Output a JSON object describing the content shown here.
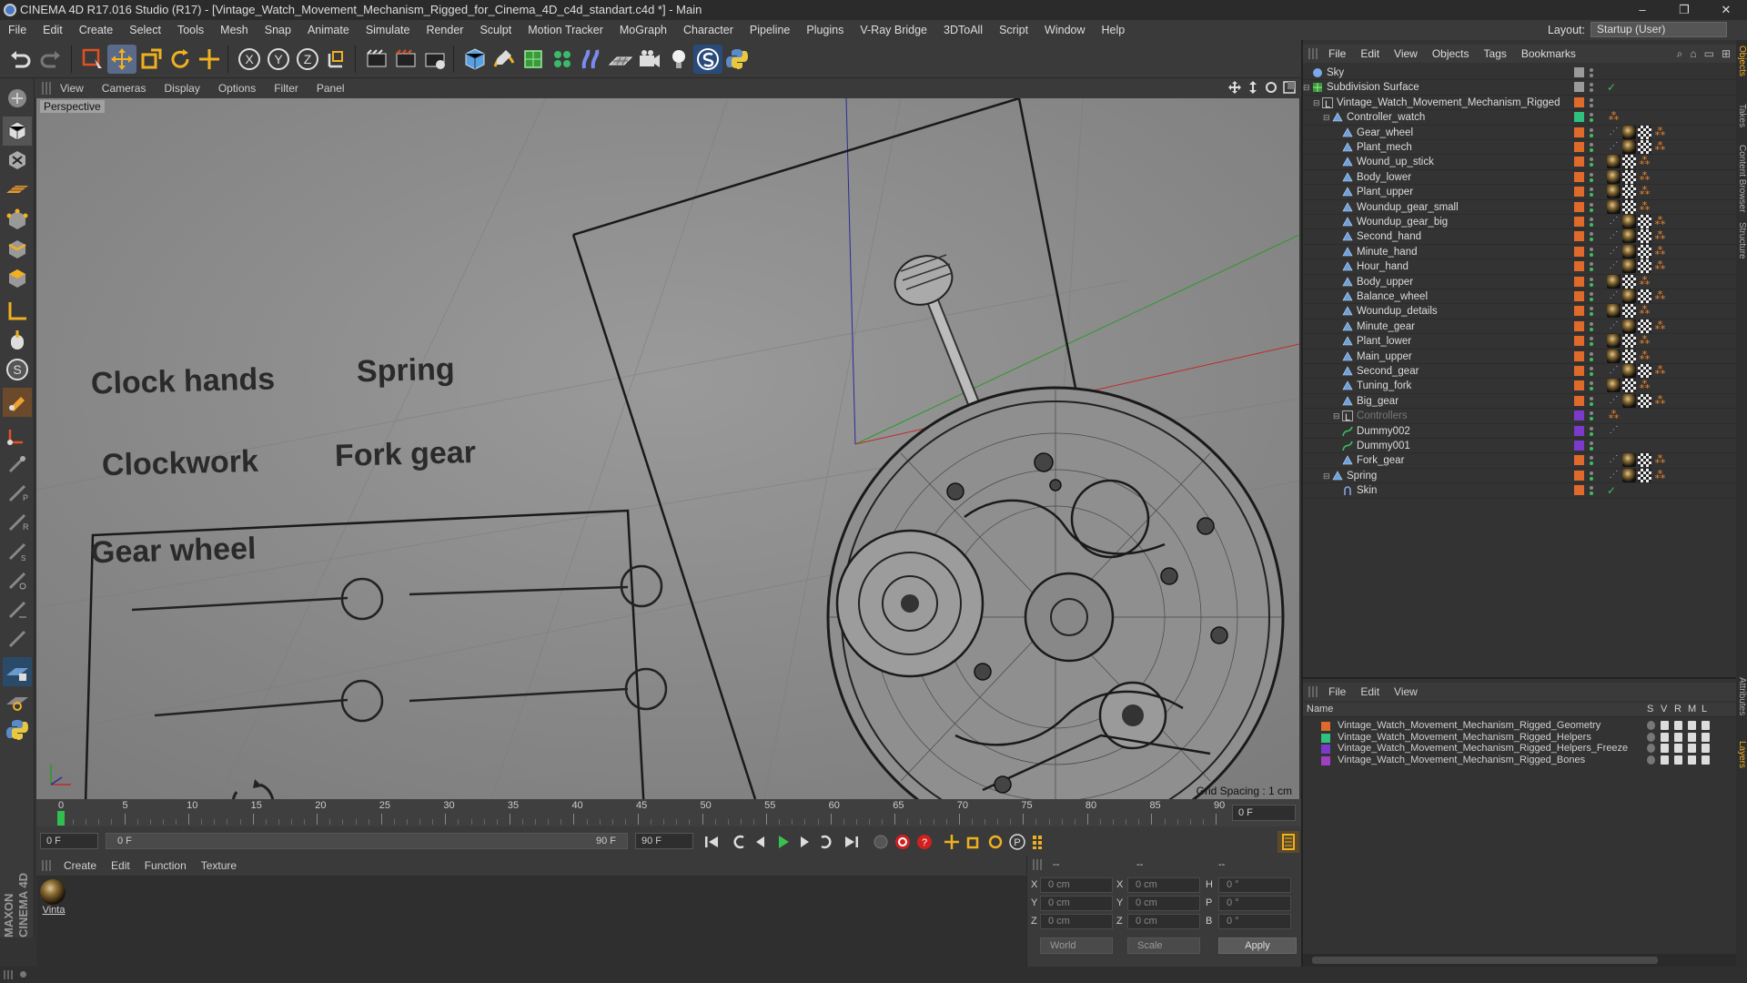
{
  "window": {
    "title": "CINEMA 4D R17.016 Studio (R17) - [Vintage_Watch_Movement_Mechanism_Rigged_for_Cinema_4D_c4d_standart.c4d *] - Main",
    "controls": [
      "–",
      "❐",
      "✕"
    ]
  },
  "menubar": {
    "items": [
      "File",
      "Edit",
      "Create",
      "Select",
      "Tools",
      "Mesh",
      "Snap",
      "Animate",
      "Simulate",
      "Render",
      "Sculpt",
      "Motion Tracker",
      "MoGraph",
      "Character",
      "Pipeline",
      "Plugins",
      "V-Ray Bridge",
      "3DToAll",
      "Script",
      "Window",
      "Help"
    ],
    "layout_label": "Layout:",
    "layout_value": "Startup (User)"
  },
  "viewport": {
    "menu": [
      "View",
      "Cameras",
      "Display",
      "Options",
      "Filter",
      "Panel"
    ],
    "camera_label": "Perspective",
    "grid_spacing": "Grid Spacing : 1 cm",
    "controller_labels": [
      "Clock hands",
      "Spring",
      "Clockwork",
      "Fork gear",
      "Gear wheel"
    ]
  },
  "timeline": {
    "ticks": [
      "0",
      "5",
      "10",
      "15",
      "20",
      "25",
      "30",
      "35",
      "40",
      "45",
      "50",
      "55",
      "60",
      "65",
      "70",
      "75",
      "80",
      "85",
      "90"
    ],
    "current_frame": "0 F"
  },
  "transport": {
    "start_field": "0 F",
    "range_start": "0 F",
    "range_end": "90 F",
    "end_field": "90 F"
  },
  "material_manager": {
    "menu": [
      "Create",
      "Edit",
      "Function",
      "Texture"
    ],
    "materials": [
      {
        "name": "Vinta"
      }
    ]
  },
  "coordinates": {
    "header": [
      "--",
      "--",
      "--"
    ],
    "rows": [
      {
        "a": "X",
        "av": "0 cm",
        "b": "X",
        "bv": "0 cm",
        "c": "H",
        "cv": "0 °"
      },
      {
        "a": "Y",
        "av": "0 cm",
        "b": "Y",
        "bv": "0 cm",
        "c": "P",
        "cv": "0 °"
      },
      {
        "a": "Z",
        "av": "0 cm",
        "b": "Z",
        "bv": "0 cm",
        "c": "B",
        "cv": "0 °"
      }
    ],
    "space": "World",
    "mode": "Scale",
    "apply": "Apply"
  },
  "object_manager": {
    "menu": [
      "File",
      "Edit",
      "View",
      "Objects",
      "Tags",
      "Bookmarks"
    ],
    "objects": [
      {
        "name": "Sky",
        "depth": 0,
        "layer": "#9a9a9a",
        "icon": "sky-icon",
        "tags": [],
        "dim": false
      },
      {
        "name": "Subdivision Surface",
        "depth": 0,
        "layer": "#9a9a9a",
        "icon": "subdivision-icon",
        "tags": [
          "check"
        ],
        "dim": false
      },
      {
        "name": "Vintage_Watch_Movement_Mechanism_Rigged",
        "depth": 1,
        "layer": "#e06a2a",
        "icon": "null-icon",
        "tags": [],
        "dim": false
      },
      {
        "name": "Controller_watch",
        "depth": 2,
        "layer": "#30c080",
        "icon": "polygon-icon",
        "tags": [
          "ik"
        ],
        "dim": false
      },
      {
        "name": "Gear_wheel",
        "depth": 3,
        "layer": "#e06a2a",
        "icon": "polygon-icon",
        "tags": [
          "pin",
          "ball",
          "chk",
          "ik"
        ],
        "dim": false
      },
      {
        "name": "Plant_mech",
        "depth": 3,
        "layer": "#e06a2a",
        "icon": "polygon-icon",
        "tags": [
          "pin",
          "ball",
          "chk",
          "ik"
        ],
        "dim": false
      },
      {
        "name": "Wound_up_stick",
        "depth": 3,
        "layer": "#e06a2a",
        "icon": "polygon-icon",
        "tags": [
          "ball",
          "chk",
          "ik"
        ],
        "dim": false
      },
      {
        "name": "Body_lower",
        "depth": 3,
        "layer": "#e06a2a",
        "icon": "polygon-icon",
        "tags": [
          "ball",
          "chk",
          "ik"
        ],
        "dim": false
      },
      {
        "name": "Plant_upper",
        "depth": 3,
        "layer": "#e06a2a",
        "icon": "polygon-icon",
        "tags": [
          "ball",
          "chk",
          "ik"
        ],
        "dim": false
      },
      {
        "name": "Woundup_gear_small",
        "depth": 3,
        "layer": "#e06a2a",
        "icon": "polygon-icon",
        "tags": [
          "ball",
          "chk",
          "ik"
        ],
        "dim": false
      },
      {
        "name": "Woundup_gear_big",
        "depth": 3,
        "layer": "#e06a2a",
        "icon": "polygon-icon",
        "tags": [
          "pin",
          "ball",
          "chk",
          "ik"
        ],
        "dim": false
      },
      {
        "name": "Second_hand",
        "depth": 3,
        "layer": "#e06a2a",
        "icon": "polygon-icon",
        "tags": [
          "pin",
          "ball",
          "chk",
          "ik"
        ],
        "dim": false
      },
      {
        "name": "Minute_hand",
        "depth": 3,
        "layer": "#e06a2a",
        "icon": "polygon-icon",
        "tags": [
          "pin",
          "ball",
          "chk",
          "ik"
        ],
        "dim": false
      },
      {
        "name": "Hour_hand",
        "depth": 3,
        "layer": "#e06a2a",
        "icon": "polygon-icon",
        "tags": [
          "pin",
          "ball",
          "chk",
          "ik"
        ],
        "dim": false
      },
      {
        "name": "Body_upper",
        "depth": 3,
        "layer": "#e06a2a",
        "icon": "polygon-icon",
        "tags": [
          "ball",
          "chk",
          "ik"
        ],
        "dim": false
      },
      {
        "name": "Balance_wheel",
        "depth": 3,
        "layer": "#e06a2a",
        "icon": "polygon-icon",
        "tags": [
          "pin",
          "ball",
          "chk",
          "ik"
        ],
        "dim": false
      },
      {
        "name": "Woundup_details",
        "depth": 3,
        "layer": "#e06a2a",
        "icon": "polygon-icon",
        "tags": [
          "ball",
          "chk",
          "ik"
        ],
        "dim": false
      },
      {
        "name": "Minute_gear",
        "depth": 3,
        "layer": "#e06a2a",
        "icon": "polygon-icon",
        "tags": [
          "pin",
          "ball",
          "chk",
          "ik"
        ],
        "dim": false
      },
      {
        "name": "Plant_lower",
        "depth": 3,
        "layer": "#e06a2a",
        "icon": "polygon-icon",
        "tags": [
          "ball",
          "chk",
          "ik"
        ],
        "dim": false
      },
      {
        "name": "Main_upper",
        "depth": 3,
        "layer": "#e06a2a",
        "icon": "polygon-icon",
        "tags": [
          "ball",
          "chk",
          "ik"
        ],
        "dim": false
      },
      {
        "name": "Second_gear",
        "depth": 3,
        "layer": "#e06a2a",
        "icon": "polygon-icon",
        "tags": [
          "pin",
          "ball",
          "chk",
          "ik"
        ],
        "dim": false
      },
      {
        "name": "Tuning_fork",
        "depth": 3,
        "layer": "#e06a2a",
        "icon": "polygon-icon",
        "tags": [
          "ball",
          "chk",
          "ik"
        ],
        "dim": false
      },
      {
        "name": "Big_gear",
        "depth": 3,
        "layer": "#e06a2a",
        "icon": "polygon-icon",
        "tags": [
          "pin",
          "ball",
          "chk",
          "ik"
        ],
        "dim": false
      },
      {
        "name": "Controllers",
        "depth": 3,
        "layer": "#7a3acc",
        "icon": "null-icon",
        "tags": [
          "ik"
        ],
        "dim": true
      },
      {
        "name": "Dummy002",
        "depth": 3,
        "layer": "#7a3acc",
        "icon": "spline-icon",
        "tags": [
          "pin"
        ],
        "dim": false
      },
      {
        "name": "Dummy001",
        "depth": 3,
        "layer": "#7a3acc",
        "icon": "spline-icon",
        "tags": [],
        "dim": false
      },
      {
        "name": "Fork_gear",
        "depth": 3,
        "layer": "#e06a2a",
        "icon": "polygon-icon",
        "tags": [
          "pin",
          "ball",
          "chk",
          "ik"
        ],
        "dim": false
      },
      {
        "name": "Spring",
        "depth": 2,
        "layer": "#e06a2a",
        "icon": "polygon-icon",
        "tags": [
          "pin",
          "ball",
          "chk",
          "ik"
        ],
        "dim": false
      },
      {
        "name": "Skin",
        "depth": 3,
        "layer": "#e06a2a",
        "icon": "skin-icon",
        "tags": [
          "check"
        ],
        "dim": false
      }
    ]
  },
  "layer_manager": {
    "menu": [
      "File",
      "Edit",
      "View"
    ],
    "header": {
      "name": "Name",
      "cols": [
        "S",
        "V",
        "R",
        "M",
        "L"
      ]
    },
    "layers": [
      {
        "name": "Vintage_Watch_Movement_Mechanism_Rigged_Geometry",
        "color": "#e06a2a"
      },
      {
        "name": "Vintage_Watch_Movement_Mechanism_Rigged_Helpers",
        "color": "#30c080"
      },
      {
        "name": "Vintage_Watch_Movement_Mechanism_Rigged_Helpers_Freeze",
        "color": "#7a3acc"
      },
      {
        "name": "Vintage_Watch_Movement_Mechanism_Rigged_Bones",
        "color": "#a040c0"
      }
    ]
  },
  "right_tabs": [
    "Objects",
    "Takes",
    "Content Browser",
    "Structure",
    "Attributes",
    "Layers"
  ]
}
